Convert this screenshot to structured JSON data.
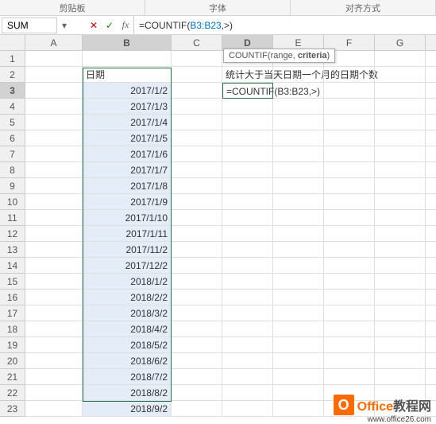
{
  "ribbon": {
    "clipboard": "剪贴板",
    "font": "字体",
    "align": "对齐方式"
  },
  "nameBox": "SUM",
  "fxPrefix": "=COUNTIF(",
  "fxRef": "B3:B23",
  "fxSuffix": ",>)",
  "tooltip": {
    "fn": "COUNTIF",
    "p1": "range",
    "p2": "criteria"
  },
  "header_date": "日期",
  "note_text": "统计大于当天日期一个月的日期个数",
  "edit_text": "=COUNTIF(B3:B23,>)",
  "dates": [
    "2017/1/2",
    "2017/1/3",
    "2017/1/4",
    "2017/1/5",
    "2017/1/6",
    "2017/1/7",
    "2017/1/8",
    "2017/1/9",
    "2017/1/10",
    "2017/1/11",
    "2017/11/2",
    "2017/12/2",
    "2018/1/2",
    "2018/2/2",
    "2018/3/2",
    "2018/4/2",
    "2018/5/2",
    "2018/6/2",
    "2018/7/2",
    "2018/8/2",
    "2018/9/2"
  ],
  "cols": [
    "A",
    "B",
    "C",
    "D",
    "E",
    "F",
    "G"
  ],
  "rowCount": 23,
  "watermark": {
    "brand": "Office",
    "suffix": "教程网",
    "url": "www.office26.com",
    "logo": "O"
  }
}
